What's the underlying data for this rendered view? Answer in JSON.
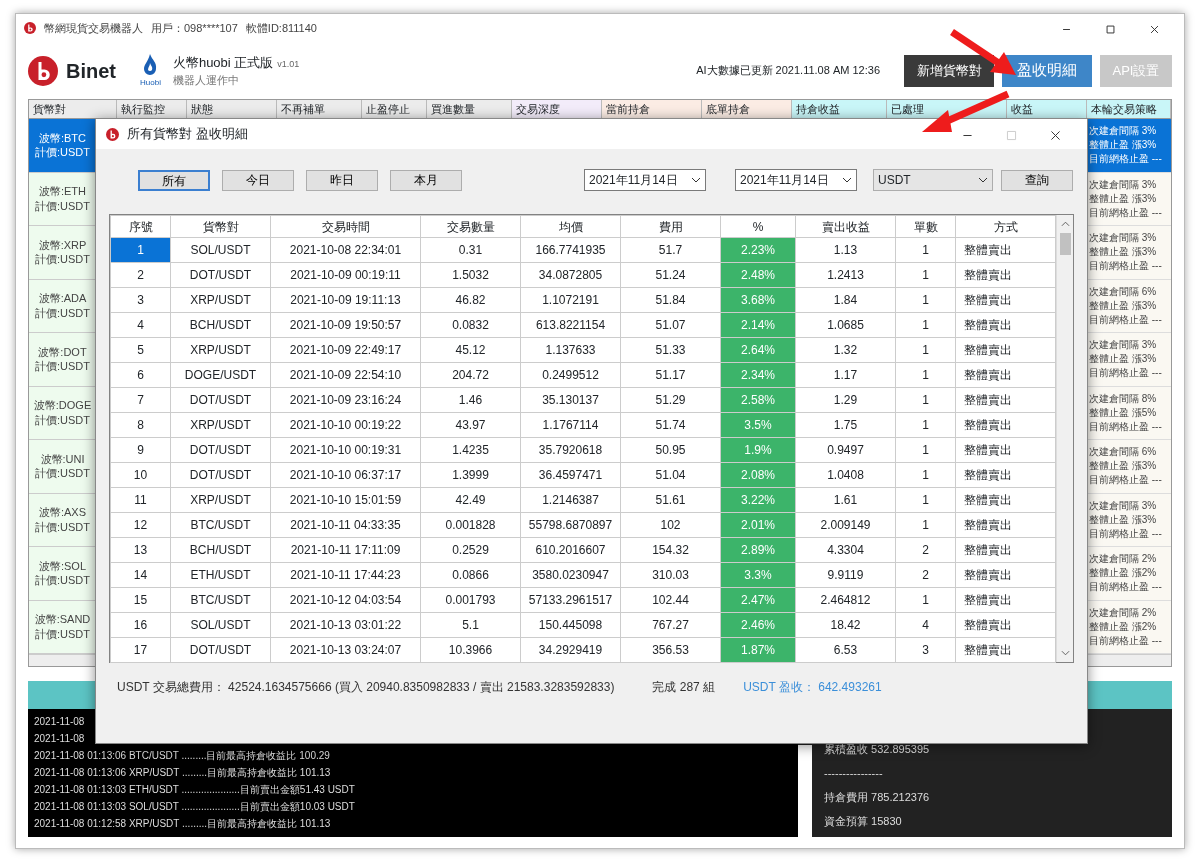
{
  "window": {
    "title": "幣網現貨交易機器人",
    "user": "用戶：098****107",
    "software_id": "軟體ID:811140"
  },
  "header": {
    "logo": "Binet",
    "exchange_caption": "Huobi",
    "edition": "火幣huobi 正式版",
    "version": "v1.01",
    "status": "機器人運作中",
    "update_note": "AI大數據已更新 2021.11.08 AM 12:36",
    "buttons": [
      {
        "label": "新增貨幣對",
        "kind": "dark"
      },
      {
        "label": "盈收明細",
        "kind": "primary"
      },
      {
        "label": "API設置",
        "kind": "disabled"
      }
    ]
  },
  "grid_columns": [
    {
      "label": "貨幣對",
      "color": "#ececec"
    },
    {
      "label": "執行監控",
      "color": "#ececec"
    },
    {
      "label": "狀態",
      "color": "#ececec"
    },
    {
      "label": "不再補單",
      "color": "#ececec"
    },
    {
      "label": "止盈停止",
      "color": "#ececec"
    },
    {
      "label": "買進數量",
      "color": "#ececec"
    },
    {
      "label": "交易深度",
      "color": "#f3ecfa"
    },
    {
      "label": "當前持倉",
      "color": "#fbece4"
    },
    {
      "label": "底單持倉",
      "color": "#fbece4"
    },
    {
      "label": "持倉收益",
      "color": "#c9f6f8"
    },
    {
      "label": "已處理",
      "color": "#c9f6f8"
    },
    {
      "label": "收益",
      "color": "#c9f6f8"
    },
    {
      "label": "本輪交易策略",
      "color": "#c9f6f8"
    }
  ],
  "pairs": [
    {
      "coin": "波幣:BTC",
      "quote": "計價:USDT",
      "selected": true,
      "strategy": [
        "次建倉間隔 3%",
        "整體止盈 漲3%",
        "目前網格止盈 ---"
      ]
    },
    {
      "coin": "波幣:ETH",
      "quote": "計價:USDT",
      "selected": false,
      "strategy": [
        "次建倉間隔 3%",
        "整體止盈 漲3%",
        "目前網格止盈 ---"
      ]
    },
    {
      "coin": "波幣:XRP",
      "quote": "計價:USDT",
      "selected": false,
      "strategy": [
        "次建倉間隔 3%",
        "整體止盈 漲3%",
        "目前網格止盈 ---"
      ]
    },
    {
      "coin": "波幣:ADA",
      "quote": "計價:USDT",
      "selected": false,
      "strategy": [
        "次建倉間隔 6%",
        "整體止盈 漲3%",
        "目前網格止盈 ---"
      ]
    },
    {
      "coin": "波幣:DOT",
      "quote": "計價:USDT",
      "selected": false,
      "strategy": [
        "次建倉間隔 3%",
        "整體止盈 漲3%",
        "目前網格止盈 ---"
      ]
    },
    {
      "coin": "波幣:DOGE",
      "quote": "計價:USDT",
      "selected": false,
      "strategy": [
        "次建倉間隔 8%",
        "整體止盈 漲5%",
        "目前網格止盈 ---"
      ]
    },
    {
      "coin": "波幣:UNI",
      "quote": "計價:USDT",
      "selected": false,
      "strategy": [
        "次建倉間隔 6%",
        "整體止盈 漲3%",
        "目前網格止盈 ---"
      ]
    },
    {
      "coin": "波幣:AXS",
      "quote": "計價:USDT",
      "selected": false,
      "strategy": [
        "次建倉間隔 3%",
        "整體止盈 漲3%",
        "目前網格止盈 ---"
      ]
    },
    {
      "coin": "波幣:SOL",
      "quote": "計價:USDT",
      "selected": false,
      "strategy": [
        "次建倉間隔 2%",
        "整體止盈 漲2%",
        "目前網格止盈 ---"
      ]
    },
    {
      "coin": "波幣:SAND",
      "quote": "計價:USDT",
      "selected": false,
      "strategy": [
        "次建倉間隔 2%",
        "整體止盈 漲2%",
        "目前網格止盈 ---"
      ]
    }
  ],
  "log": [
    "2021-11-08",
    "2021-11-08",
    "2021-11-08 01:13:06 BTC/USDT .........目前最高持倉收益比 100.29",
    "2021-11-08 01:13:06 XRP/USDT .........目前最高持倉收益比 101.13",
    "2021-11-08 01:13:03 ETH/USDT .....................目前賣出金額51.43 USDT",
    "2021-11-08 01:13:03 SOL/USDT .....................目前賣出金額10.03 USDT",
    "2021-11-08 01:12:58 XRP/USDT .........目前最高持倉收益比 101.13"
  ],
  "stats": [
    "累積盈收 532.895395",
    "----------------",
    "持倉費用 785.212376",
    "資金預算 15830"
  ],
  "dialog": {
    "title": "所有貨幣對 盈收明細",
    "filters": [
      {
        "label": "所有",
        "selected": true
      },
      {
        "label": "今日",
        "selected": false
      },
      {
        "label": "昨日",
        "selected": false
      },
      {
        "label": "本月",
        "selected": false
      }
    ],
    "date_from": "2021年11月14日",
    "date_to": "2021年11月14日",
    "currency": "USDT",
    "query_button": "查詢",
    "columns": [
      {
        "label": "序號",
        "kind": "index"
      },
      {
        "label": "貨幣對",
        "kind": "text"
      },
      {
        "label": "交易時間",
        "kind": "text"
      },
      {
        "label": "交易數量",
        "kind": "text"
      },
      {
        "label": "均價",
        "kind": "text"
      },
      {
        "label": "費用",
        "kind": "text"
      },
      {
        "label": "%",
        "kind": "percent"
      },
      {
        "label": "賣出收益",
        "kind": "text"
      },
      {
        "label": "單數",
        "kind": "text"
      },
      {
        "label": "方式",
        "kind": "left"
      }
    ],
    "rows": [
      {
        "selected": true,
        "cells": [
          "1",
          "SOL/USDT",
          "2021-10-08 22:34:01",
          "0.31",
          "166.7741935",
          "51.7",
          "2.23%",
          "1.13",
          "1",
          "整體賣出"
        ]
      },
      {
        "selected": false,
        "cells": [
          "2",
          "DOT/USDT",
          "2021-10-09 00:19:11",
          "1.5032",
          "34.0872805",
          "51.24",
          "2.48%",
          "1.2413",
          "1",
          "整體賣出"
        ]
      },
      {
        "selected": false,
        "cells": [
          "3",
          "XRP/USDT",
          "2021-10-09 19:11:13",
          "46.82",
          "1.1072191",
          "51.84",
          "3.68%",
          "1.84",
          "1",
          "整體賣出"
        ]
      },
      {
        "selected": false,
        "cells": [
          "4",
          "BCH/USDT",
          "2021-10-09 19:50:57",
          "0.0832",
          "613.8221154",
          "51.07",
          "2.14%",
          "1.0685",
          "1",
          "整體賣出"
        ]
      },
      {
        "selected": false,
        "cells": [
          "5",
          "XRP/USDT",
          "2021-10-09 22:49:17",
          "45.12",
          "1.137633",
          "51.33",
          "2.64%",
          "1.32",
          "1",
          "整體賣出"
        ]
      },
      {
        "selected": false,
        "cells": [
          "6",
          "DOGE/USDT",
          "2021-10-09 22:54:10",
          "204.72",
          "0.2499512",
          "51.17",
          "2.34%",
          "1.17",
          "1",
          "整體賣出"
        ]
      },
      {
        "selected": false,
        "cells": [
          "7",
          "DOT/USDT",
          "2021-10-09 23:16:24",
          "1.46",
          "35.130137",
          "51.29",
          "2.58%",
          "1.29",
          "1",
          "整體賣出"
        ]
      },
      {
        "selected": false,
        "cells": [
          "8",
          "XRP/USDT",
          "2021-10-10 00:19:22",
          "43.97",
          "1.1767114",
          "51.74",
          "3.5%",
          "1.75",
          "1",
          "整體賣出"
        ]
      },
      {
        "selected": false,
        "cells": [
          "9",
          "DOT/USDT",
          "2021-10-10 00:19:31",
          "1.4235",
          "35.7920618",
          "50.95",
          "1.9%",
          "0.9497",
          "1",
          "整體賣出"
        ]
      },
      {
        "selected": false,
        "cells": [
          "10",
          "DOT/USDT",
          "2021-10-10 06:37:17",
          "1.3999",
          "36.4597471",
          "51.04",
          "2.08%",
          "1.0408",
          "1",
          "整體賣出"
        ]
      },
      {
        "selected": false,
        "cells": [
          "11",
          "XRP/USDT",
          "2021-10-10 15:01:59",
          "42.49",
          "1.2146387",
          "51.61",
          "3.22%",
          "1.61",
          "1",
          "整體賣出"
        ]
      },
      {
        "selected": false,
        "cells": [
          "12",
          "BTC/USDT",
          "2021-10-11 04:33:35",
          "0.001828",
          "55798.6870897",
          "102",
          "2.01%",
          "2.009149",
          "1",
          "整體賣出"
        ]
      },
      {
        "selected": false,
        "cells": [
          "13",
          "BCH/USDT",
          "2021-10-11 17:11:09",
          "0.2529",
          "610.2016607",
          "154.32",
          "2.89%",
          "4.3304",
          "2",
          "整體賣出"
        ]
      },
      {
        "selected": false,
        "cells": [
          "14",
          "ETH/USDT",
          "2021-10-11 17:44:23",
          "0.0866",
          "3580.0230947",
          "310.03",
          "3.3%",
          "9.9119",
          "2",
          "整體賣出"
        ]
      },
      {
        "selected": false,
        "cells": [
          "15",
          "BTC/USDT",
          "2021-10-12 04:03:54",
          "0.001793",
          "57133.2961517",
          "102.44",
          "2.47%",
          "2.464812",
          "1",
          "整體賣出"
        ]
      },
      {
        "selected": false,
        "cells": [
          "16",
          "SOL/USDT",
          "2021-10-13 03:01:22",
          "5.1",
          "150.445098",
          "767.27",
          "2.46%",
          "18.42",
          "4",
          "整體賣出"
        ]
      },
      {
        "selected": false,
        "cells": [
          "17",
          "DOT/USDT",
          "2021-10-13 03:24:07",
          "10.3966",
          "34.2929419",
          "356.53",
          "1.87%",
          "6.53",
          "3",
          "整體賣出"
        ]
      }
    ],
    "summary": {
      "fees": "USDT  交易總費用： 42524.1634575666 (買入 20940.8350982833 / 賣出 21583.3283592833)",
      "completed": "完成 287 組",
      "profit": "USDT 盈收： 642.493261"
    }
  }
}
